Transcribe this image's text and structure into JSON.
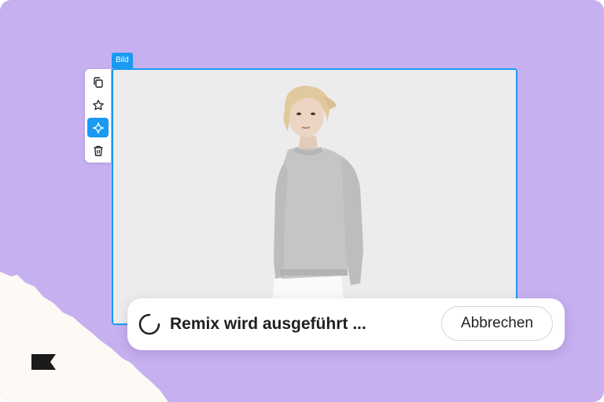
{
  "frame": {
    "label": "Bild"
  },
  "toolbar": {
    "items": [
      {
        "icon": "copy-icon",
        "state": "default"
      },
      {
        "icon": "star-icon",
        "state": "default"
      },
      {
        "icon": "sparkle-icon",
        "state": "active"
      },
      {
        "icon": "trash-icon",
        "state": "default"
      }
    ]
  },
  "status": {
    "text": "Remix wird ausgeführt ...",
    "cancel_label": "Abbrechen"
  },
  "colors": {
    "background": "#c7b0ef",
    "accent": "#1a9af0",
    "paper": "#fdfaf5"
  }
}
